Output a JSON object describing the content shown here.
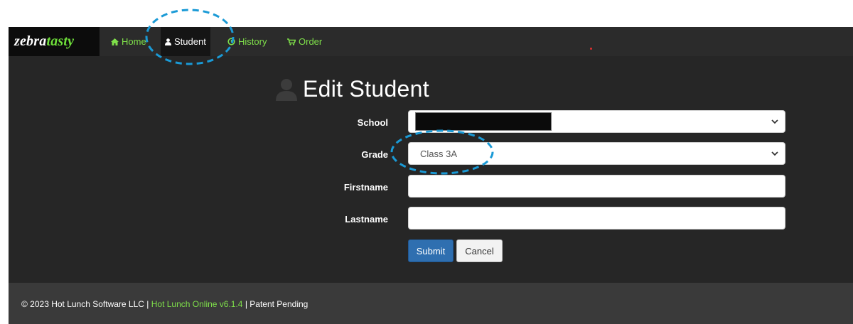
{
  "brand": {
    "part1": "zebra",
    "part2": "tasty",
    "accent_color": "#6fe03a"
  },
  "nav": {
    "items": [
      {
        "label": "Home",
        "icon": "home-icon"
      },
      {
        "label": "Student",
        "icon": "user-icon",
        "active": true
      },
      {
        "label": "History",
        "icon": "history-icon"
      },
      {
        "label": "Order",
        "icon": "cart-icon"
      }
    ]
  },
  "page": {
    "title": "Edit Student",
    "title_icon": "user-icon"
  },
  "form": {
    "school": {
      "label": "School",
      "value": "",
      "redacted": true
    },
    "grade": {
      "label": "Grade",
      "value": "Class 3A"
    },
    "firstname": {
      "label": "Firstname",
      "value": ""
    },
    "lastname": {
      "label": "Lastname",
      "value": ""
    },
    "submit_label": "Submit",
    "cancel_label": "Cancel"
  },
  "footer": {
    "copyright": "© 2023 Hot Lunch Software LLC | ",
    "product_link": "Hot Lunch Online v6.1.4",
    "tail": " | Patent Pending"
  },
  "colors": {
    "nav_link": "#7fe04a",
    "submit_bg": "#2f6fb0",
    "annotation": "#1a9ad6"
  }
}
